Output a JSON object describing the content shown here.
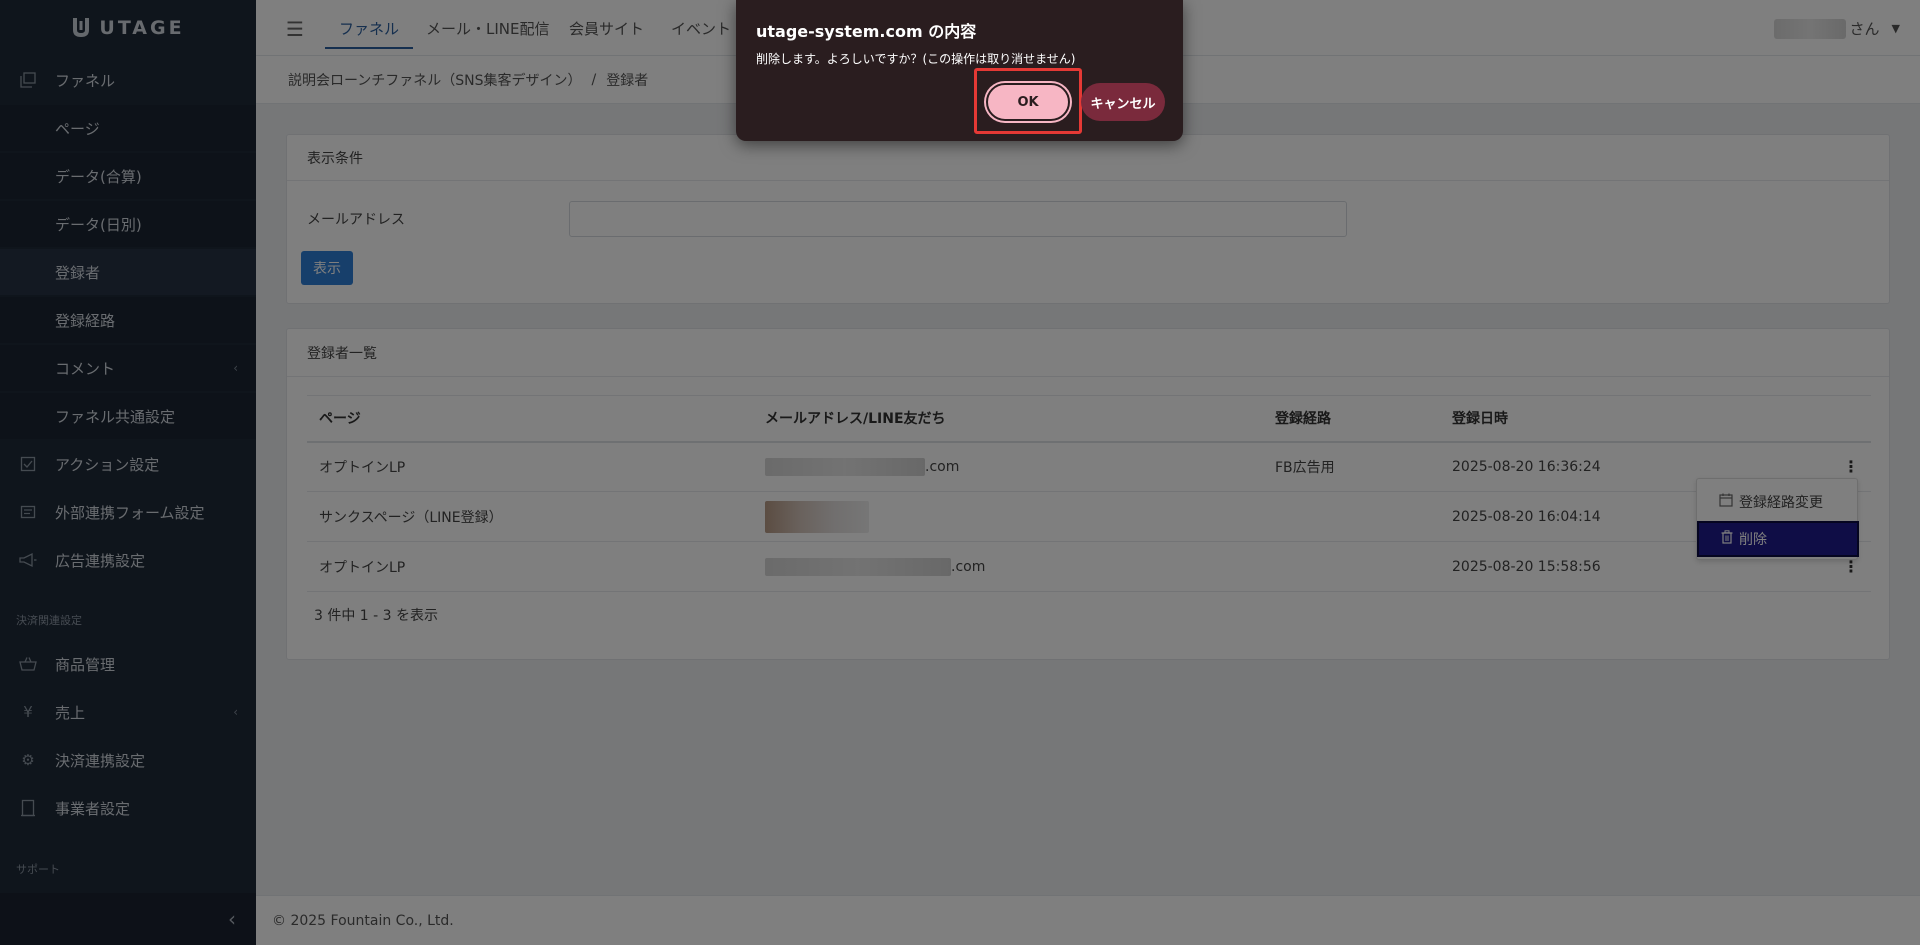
{
  "app": {
    "logo_text": "UTAGE"
  },
  "sidebar": {
    "items": [
      {
        "label": "ファネル",
        "icon": "copy-icon"
      },
      {
        "label": "ページ"
      },
      {
        "label": "データ(合算)"
      },
      {
        "label": "データ(日別)"
      },
      {
        "label": "登録者"
      },
      {
        "label": "登録経路"
      },
      {
        "label": "コメント"
      },
      {
        "label": "ファネル共通設定"
      },
      {
        "label": "アクション設定",
        "icon": "check-square-icon"
      },
      {
        "label": "外部連携フォーム設定",
        "icon": "form-icon"
      },
      {
        "label": "広告連携設定",
        "icon": "megaphone-icon"
      },
      {
        "label": "商品管理",
        "icon": "basket-icon"
      },
      {
        "label": "売上",
        "icon": "yen-icon"
      },
      {
        "label": "決済連携設定",
        "icon": "gear-icon"
      },
      {
        "label": "事業者設定",
        "icon": "building-icon"
      }
    ],
    "section_payment": "決済関連設定",
    "section_support": "サポート"
  },
  "header": {
    "tabs": [
      {
        "label": "ファネル"
      },
      {
        "label": "メール・LINE配信"
      },
      {
        "label": "会員サイト"
      },
      {
        "label": "イベント・"
      }
    ],
    "user_suffix": "さん"
  },
  "breadcrumb": {
    "parent": "説明会ローンチファネル（SNS集客デザイン）",
    "separator": "/",
    "current": "登録者"
  },
  "filter": {
    "title": "表示条件",
    "email_label": "メールアドレス",
    "email_value": "",
    "show_button": "表示"
  },
  "list": {
    "title": "登録者一覧",
    "columns": [
      "ページ",
      "メールアドレス/LINE友だち",
      "登録経路",
      "登録日時"
    ],
    "rows": [
      {
        "page": "オプトインLP",
        "email_suffix": ".com",
        "route": "FB広告用",
        "date": "2025-08-20 16:36:24"
      },
      {
        "page": "サンクスページ（LINE登録）",
        "email_suffix": "",
        "route": "",
        "date": "2025-08-20 16:04:14"
      },
      {
        "page": "オプトインLP",
        "email_suffix": ".com",
        "route": "",
        "date": "2025-08-20 15:58:56"
      }
    ],
    "count_text": "3 件中 1 - 3 を表示"
  },
  "row_menu": {
    "change_route": "登録経路変更",
    "delete": "削除"
  },
  "footer": {
    "copyright": "© 2025 Fountain Co., Ltd."
  },
  "dialog": {
    "title": "utage-system.com の内容",
    "message": "削除します。よろしいですか？(この操作は取り消せません)",
    "ok_label": "OK",
    "cancel_label": "キャンセル"
  },
  "colors": {
    "sidebar_bg": "#1f2a38",
    "accent": "#2f7fd6",
    "dialog_bg": "#2a1d1f",
    "ok_button": "#f7b6c4",
    "cancel_button": "#7a2a3c",
    "highlight": "#e53935",
    "menu_active": "#1e1a8c"
  }
}
